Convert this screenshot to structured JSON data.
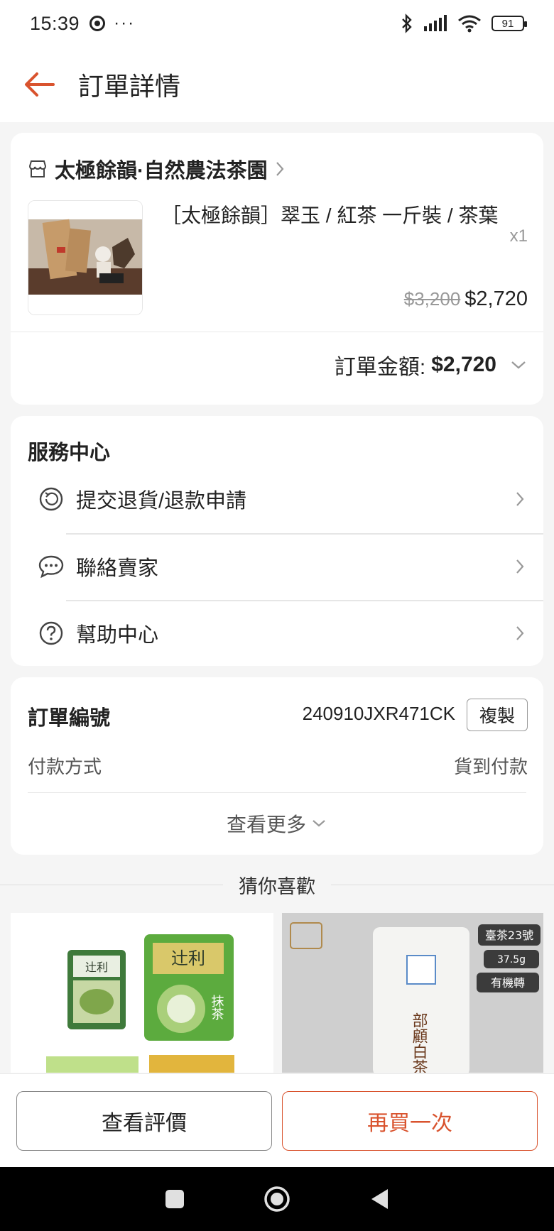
{
  "status_bar": {
    "time": "15:39",
    "battery": "91"
  },
  "header": {
    "title": "訂單詳情"
  },
  "order": {
    "shop_name": "太極餘韻·自然農法茶園",
    "product_name": "［太極餘韻］翠玉 / 紅茶 一斤裝 / 茶葉",
    "quantity": "x1",
    "original_price": "$3,200",
    "price": "$2,720",
    "total_label": "訂單金額:",
    "total_amount": "$2,720"
  },
  "service_center": {
    "title": "服務中心",
    "items": [
      {
        "label": "提交退貨/退款申請",
        "icon": "return-icon"
      },
      {
        "label": "聯絡賣家",
        "icon": "chat-icon"
      },
      {
        "label": "幫助中心",
        "icon": "help-icon"
      }
    ]
  },
  "order_info": {
    "number_label": "訂單編號",
    "number_value": "240910JXR471CK",
    "copy_label": "複製",
    "payment_label": "付款方式",
    "payment_value": "貨到付款",
    "more_label": "查看更多"
  },
  "recommend": {
    "title": "猜你喜歡",
    "items": [
      {
        "brand": "辻利",
        "text": "抹茶"
      },
      {
        "tag1": "臺茶23號",
        "tag2": "37.5g",
        "tag3": "有機轉",
        "product": "部顧白茶"
      }
    ]
  },
  "actions": {
    "review_label": "查看評價",
    "buy_again_label": "再買一次"
  },
  "colors": {
    "accent": "#d9532e",
    "background": "#f5f5f5"
  }
}
